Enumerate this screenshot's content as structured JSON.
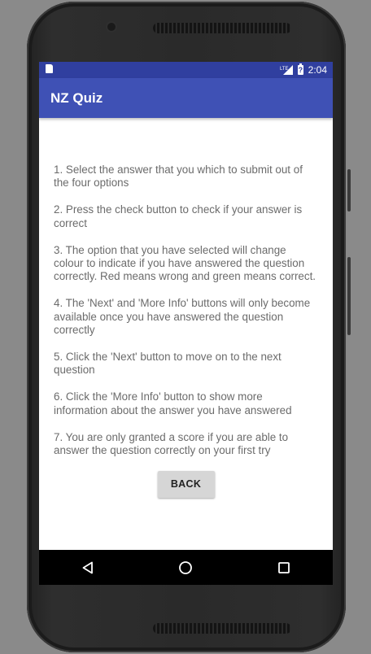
{
  "status_bar": {
    "network": "LTE",
    "time": "2:04",
    "icons": [
      "sd-card-icon",
      "lte-signal-icon",
      "battery-charging-icon"
    ]
  },
  "app_bar": {
    "title": "NZ Quiz"
  },
  "instructions": [
    "1. Select the answer that you which to submit out of the four options",
    "2. Press the check button to check if your answer is correct",
    "3. The option that you have selected will change colour to indicate if you have answered the question correctly. Red means wrong and green means correct.",
    "4. The 'Next' and 'More Info' buttons will only become available once you have answered the question correctly",
    "5. Click the 'Next' button to move on to the next question",
    "6. Click the 'More Info' button to show more information about the answer you have answered",
    "7. You are only granted a score if you are able to answer the question correctly on your first try"
  ],
  "back_button": {
    "label": "BACK"
  },
  "nav_bar": {
    "icons": [
      "back-triangle-icon",
      "home-circle-icon",
      "recents-square-icon"
    ]
  },
  "colors": {
    "primary": "#3f51b5",
    "primary_dark": "#303f9f",
    "text": "#6b6b6b",
    "button": "#d6d6d6"
  }
}
